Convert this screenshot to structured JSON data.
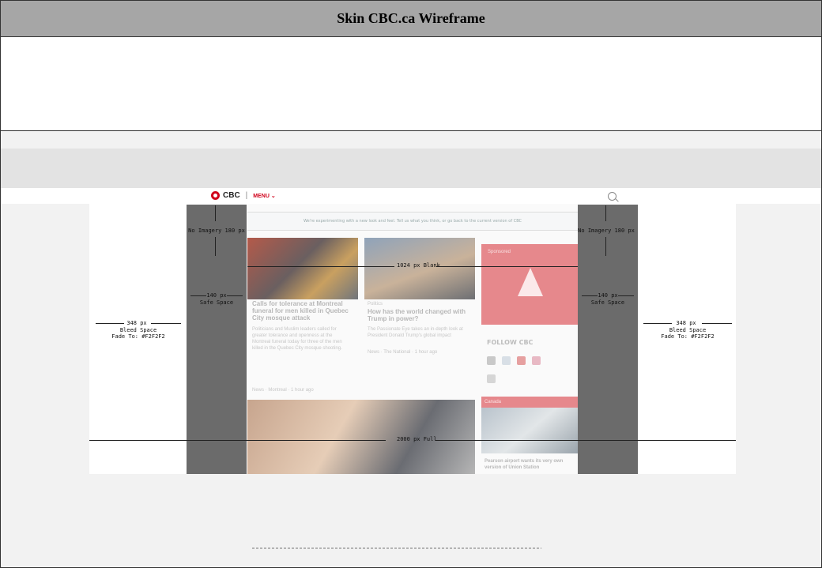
{
  "title": "Skin CBC.ca Wireframe",
  "header": {
    "logo_text": "CBC",
    "menu_label": "MENU ⌄"
  },
  "labels": {
    "no_imagery": "No Imagery 180 px",
    "safe_space_px": "140 px",
    "safe_space": "Safe Space",
    "bleed_px": "348 px",
    "bleed_space": "Bleed Space",
    "fade_to": "Fade To: #F2F2F2",
    "blank_1024": "1024 px Blank",
    "full_2000": "2000 px Full"
  },
  "content": {
    "banner": "We're experimenting with a new look and feel. Tell us what you think, or go back to the current version of CBC",
    "story1_headline": "Calls for tolerance at Montreal funeral for men killed in Quebec City mosque attack",
    "story1_body": "Politicians and Muslim leaders called for greater tolerance and openness at the Montreal funeral today for three of the men killed in the Quebec City mosque shooting.",
    "story1_meta": "News · Montreal · 1 hour ago",
    "story2_kicker": "Politics",
    "story2_headline": "How has the world changed with Trump in power?",
    "story2_body": "The Passionate Eye takes an in-depth look at President Donald Trump's global impact",
    "story2_meta": "News · The National · 1 hour ago",
    "ad_caption": "Sponsored",
    "follow_title": "FOLLOW CBC",
    "news_bar_label": "Canada",
    "photo4_headline": "Pearson airport wants its very own version of Union Station"
  },
  "colors": {
    "title_bar": "#a6a6a6",
    "canvas": "#f2f2f2",
    "cbc_red": "#d0021b",
    "overlay": "#4a4a4a"
  },
  "icons": {
    "logo": "cbc-gem-icon",
    "search": "search-icon",
    "facebook": "facebook-icon",
    "twitter": "twitter-icon",
    "youtube": "youtube-icon",
    "instagram": "instagram-icon",
    "feed": "rss-icon"
  }
}
